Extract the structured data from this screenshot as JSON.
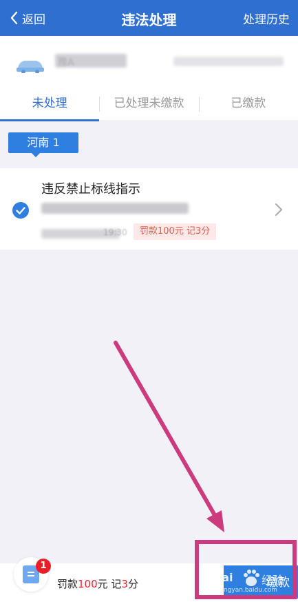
{
  "header": {
    "back_label": "返回",
    "title": "违法处理",
    "history_label": "处理历史"
  },
  "vehicle": {
    "plate": "豫A",
    "vin": ""
  },
  "tabs": [
    {
      "label": "未处理",
      "active": true
    },
    {
      "label": "已处理未缴款",
      "active": false
    },
    {
      "label": "已缴款",
      "active": false
    }
  ],
  "region_tag": "河南 1",
  "violation": {
    "title": "违反禁止标线指示",
    "location": "",
    "time": "19:30",
    "fine_badge": "罚款100元 记3分",
    "selected": true
  },
  "bottom_bar": {
    "badge_count": "1",
    "summary_prefix": "罚款",
    "fine_amount": "100",
    "summary_middle": "元 记",
    "points": "3",
    "summary_suffix": "分",
    "pay_label": "缴款"
  },
  "watermark": {
    "brand": "Bai",
    "text": "经验",
    "url": "jingyan.baidu.com"
  },
  "colors": {
    "primary": "#2f6fd0",
    "accent": "#2f7fe0",
    "fine_red": "#e8202a",
    "annotation": "#cc3b7d"
  }
}
